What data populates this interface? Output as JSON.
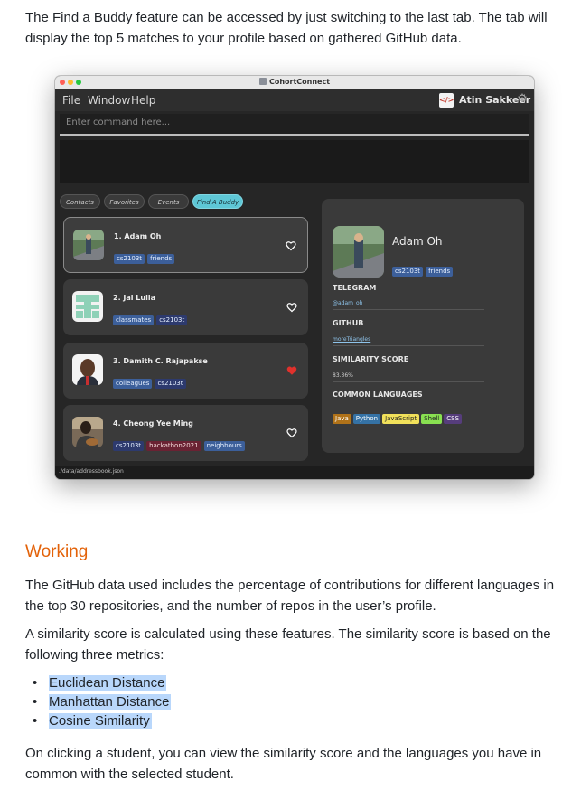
{
  "doc": {
    "intro": "The Find a Buddy feature can be accessed by just switching to the last tab. The tab will display the top 5 matches to your profile based on gathered GitHub data.",
    "section_title": "Working",
    "p1": "The GitHub data used includes the percentage of contributions for different languages in the top 30 repositories, and the number of repos in the user’s profile.",
    "p2": "A similarity score is calculated using these features. The similarity score is based on the following three metrics:",
    "metrics": [
      "Euclidean Distance",
      "Manhattan Distance",
      "Cosine Similarity"
    ],
    "p3": "On clicking a student, you can view the similarity score and the languages you have in common with the selected student."
  },
  "app": {
    "window_title": "CohortConnect",
    "menu": [
      "File",
      "Window",
      "Help"
    ],
    "user_logo": "</>",
    "user_name": "Atin Sakkeer",
    "command_placeholder": "Enter command here...",
    "tabs": [
      "Contacts",
      "Favorites",
      "Events",
      "Find A Buddy"
    ],
    "cards": [
      {
        "name": "1.  Adam Oh",
        "tags": [
          "cs2103t",
          "friends"
        ],
        "favorite": false
      },
      {
        "name": "2.  Jai Lulla",
        "tags": [
          "classmates",
          "cs2103t"
        ],
        "favorite": false
      },
      {
        "name": "3.  Damith C. Rajapakse",
        "tags": [
          "colleagues",
          "cs2103t"
        ],
        "favorite": true
      },
      {
        "name": "4.  Cheong Yee Ming",
        "tags": [
          "cs2103t",
          "hackathon2021",
          "neighbours"
        ],
        "favorite": false
      }
    ],
    "detail": {
      "name": "Adam Oh",
      "tags": [
        "cs2103t",
        "friends"
      ],
      "telegram_label": "TELEGRAM",
      "telegram": "@adam_oh",
      "github_label": "GITHUB",
      "github": "moreTriangles",
      "similarity_label": "SIMILARITY SCORE",
      "similarity": "83.36%",
      "languages_label": "COMMON LANGUAGES",
      "languages": [
        {
          "name": "Java",
          "color": "#b07219"
        },
        {
          "name": "Python",
          "color": "#3572a5"
        },
        {
          "name": "JavaScript",
          "color": "#f1e05a"
        },
        {
          "name": "Shell",
          "color": "#89e051"
        },
        {
          "name": "CSS",
          "color": "#563d7c"
        }
      ]
    },
    "status": "./data/addressbook.json"
  }
}
